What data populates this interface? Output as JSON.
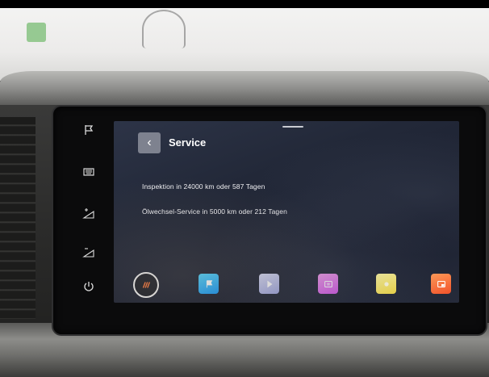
{
  "screen": {
    "title": "Service",
    "back_glyph": "‹",
    "lines": [
      "Inspektion in 24000 km oder 587 Tagen",
      "Ölwechsel-Service in 5000 km oder 212 Tagen"
    ]
  },
  "side_buttons": [
    {
      "icon": "flag-icon"
    },
    {
      "icon": "keyboard-icon"
    },
    {
      "icon": "brightness-up-icon"
    },
    {
      "icon": "brightness-down-icon"
    },
    {
      "icon": "power-icon"
    }
  ],
  "dock": [
    {
      "icon": "home-icon",
      "color": "#1c1f28"
    },
    {
      "icon": "flag-icon",
      "color": "#1e9cf3"
    },
    {
      "icon": "play-icon",
      "color": "#aeb3e6"
    },
    {
      "icon": "media-icon",
      "color": "#e06de8"
    },
    {
      "icon": "app-icon",
      "color": "#f5df52"
    },
    {
      "icon": "car-icon",
      "color": "#f46a35"
    }
  ]
}
